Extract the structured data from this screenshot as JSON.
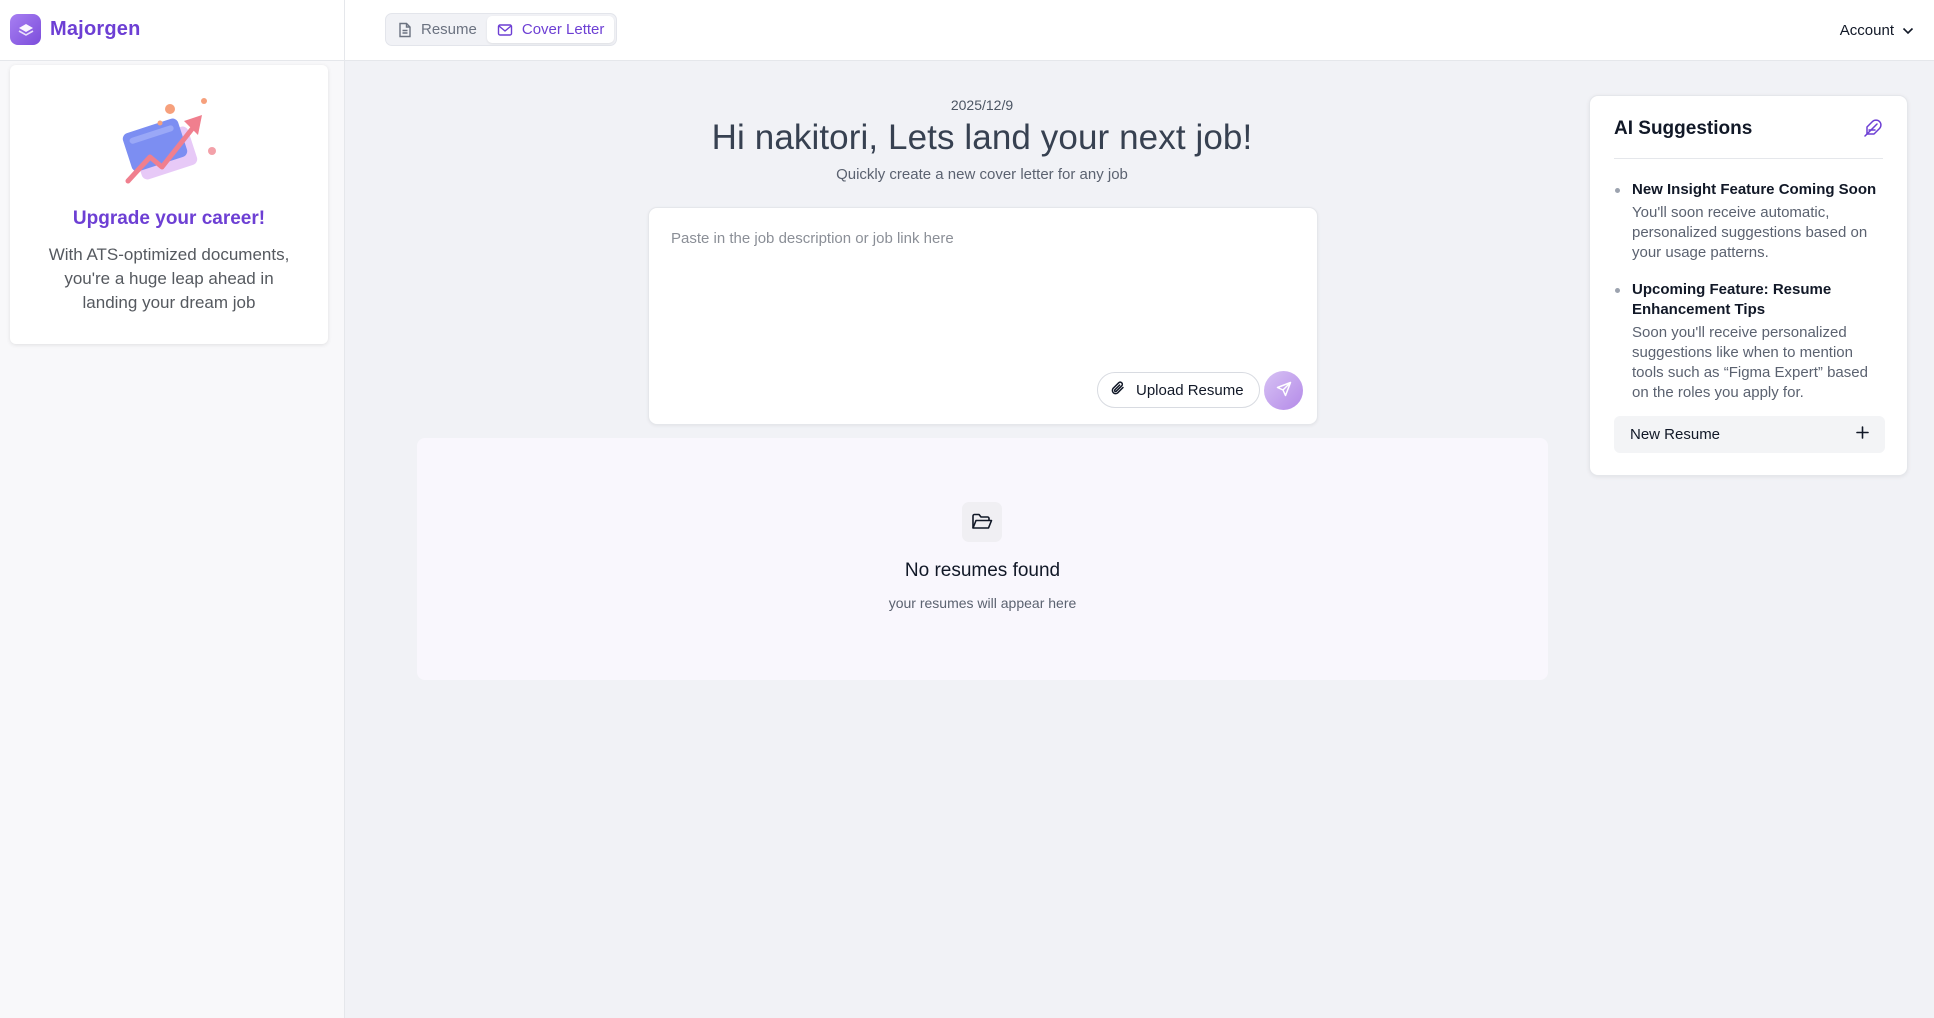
{
  "app": {
    "name": "Majorgen",
    "accent": "#6d3fd4"
  },
  "tabs": [
    {
      "label": "Resume",
      "icon": "document-icon",
      "active": false
    },
    {
      "label": "Cover Letter",
      "icon": "mail-icon",
      "active": true
    }
  ],
  "account": {
    "label": "Account",
    "icon": "chevron-down-icon"
  },
  "sidebar": {
    "promo": {
      "title": "Upgrade your career!",
      "text": "With ATS-optimized documents, you're a huge leap ahead in landing your dream job"
    }
  },
  "main": {
    "date": "2025/12/9",
    "greeting": "Hi nakitori, Lets land your next job!",
    "subtitle": "Quickly create a new cover letter for any job",
    "composer": {
      "placeholder": "Paste in the job description or job link here",
      "value": "",
      "upload_label": "Upload Resume",
      "upload_icon": "paperclip-icon",
      "send_icon": "send-icon"
    },
    "empty": {
      "icon": "folder-open-icon",
      "title": "No resumes found",
      "text": "your resumes will appear here"
    }
  },
  "ai": {
    "title": "AI Suggestions",
    "icon": "feather-icon",
    "suggestions": [
      {
        "title": "New Insight Feature Coming Soon",
        "text": "You'll soon receive automatic, personalized suggestions based on your usage patterns."
      },
      {
        "title": "Upcoming Feature: Resume Enhancement Tips",
        "text": "Soon you'll receive personalized suggestions like when to mention tools such as “Figma Expert” based on the roles you apply for."
      }
    ],
    "new_resume_label": "New Resume",
    "new_resume_icon": "plus-icon"
  }
}
